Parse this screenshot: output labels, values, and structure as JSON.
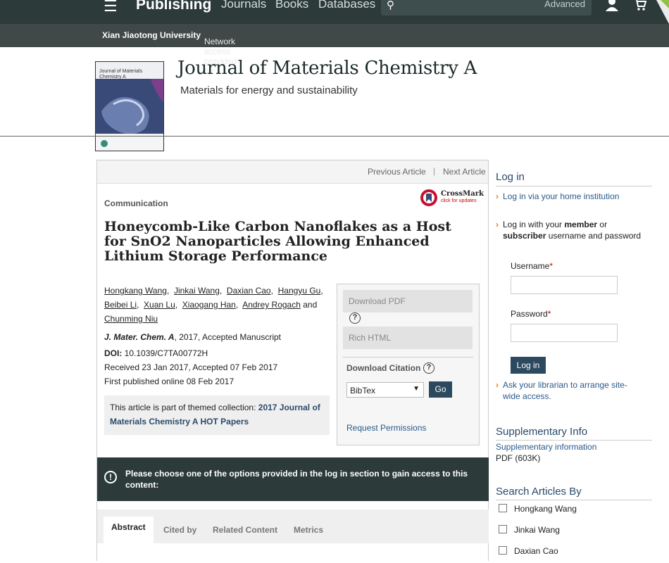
{
  "topbar": {
    "menu_icon": "hamburger-icon",
    "brand": "Publishing",
    "nav": [
      "Journals",
      "Books",
      "Databases"
    ],
    "search_icon": "search-icon",
    "search_advanced": "Advanced",
    "user_icon": "user-icon",
    "cart_icon": "cart-icon"
  },
  "access": {
    "prefix": "Network access provided by: ",
    "institution": "Xian Jiaotong University"
  },
  "journal": {
    "cover_text": "Journal of Materials Chemistry A",
    "title": "Journal of Materials Chemistry A",
    "subtitle": "Materials for energy and sustainability"
  },
  "article_nav": {
    "previous": "Previous Article",
    "separator": "|",
    "next": "Next Article"
  },
  "article": {
    "type": "Communication",
    "crossmark_label": "CrossMark",
    "crossmark_sub": "click for updates",
    "title": "Honeycomb-Like Carbon Nanoflakes as a Host for SnO2 Nanoparticles Allowing Enhanced Lithium Storage Performance",
    "authors": [
      "Hongkang Wang",
      "Jinkai Wang",
      "Daxian Cao",
      "Hangyu Gu",
      "Beibei Li",
      "Xuan Lu",
      "Xiaogang Han",
      "Andrey Rogach",
      "Chunming Niu"
    ],
    "authors_and": "and",
    "journal_abbrev": "J. Mater. Chem. A",
    "journal_rest": ", 2017, Accepted Manuscript",
    "doi_label": "DOI:",
    "doi_value": " 10.1039/C7TA00772H",
    "received": "Received 23 Jan 2017, Accepted 07 Feb 2017",
    "published": "First published online 08 Feb 2017",
    "themed_prefix": "This article is part of themed collection: ",
    "themed_link": "2017 Journal of Materials Chemistry A HOT Papers"
  },
  "download": {
    "pdf": "Download PDF",
    "rich_html": "Rich HTML",
    "help": "?",
    "citation_label": "Download Citation",
    "citation_format": "BibTex",
    "go": "Go",
    "permissions": "Request Permissions"
  },
  "banner": {
    "icon": "alert-icon",
    "text": "Please choose one of the options provided in the log in section to gain access to this content:"
  },
  "tabs": [
    "Abstract",
    "Cited by",
    "Related Content",
    "Metrics"
  ],
  "sidebar": {
    "login_title": "Log in",
    "login_home": "Log in via your home institution",
    "login_member_pre": "Log in with your ",
    "login_member_b1": "member",
    "login_member_or": " or ",
    "login_member_b2": "subscriber",
    "login_member_post": " username and password",
    "username_label": "Username",
    "password_label": "Password",
    "required_mark": "*",
    "login_button": "Log in",
    "librarian": "Ask your librarian to arrange site-wide access.",
    "supp_title": "Supplementary Info",
    "supp_link": "Supplementary information",
    "supp_size": "PDF (603K)",
    "search_title": "Search Articles By",
    "search_authors": [
      "Hongkang Wang",
      "Jinkai Wang",
      "Daxian Cao"
    ]
  },
  "colors": {
    "topbar": "#2c3a3a",
    "accessbar": "#414848",
    "link": "#2a5a8a",
    "button": "#2c4a5f",
    "accent_chevron": "#e07a2a"
  }
}
